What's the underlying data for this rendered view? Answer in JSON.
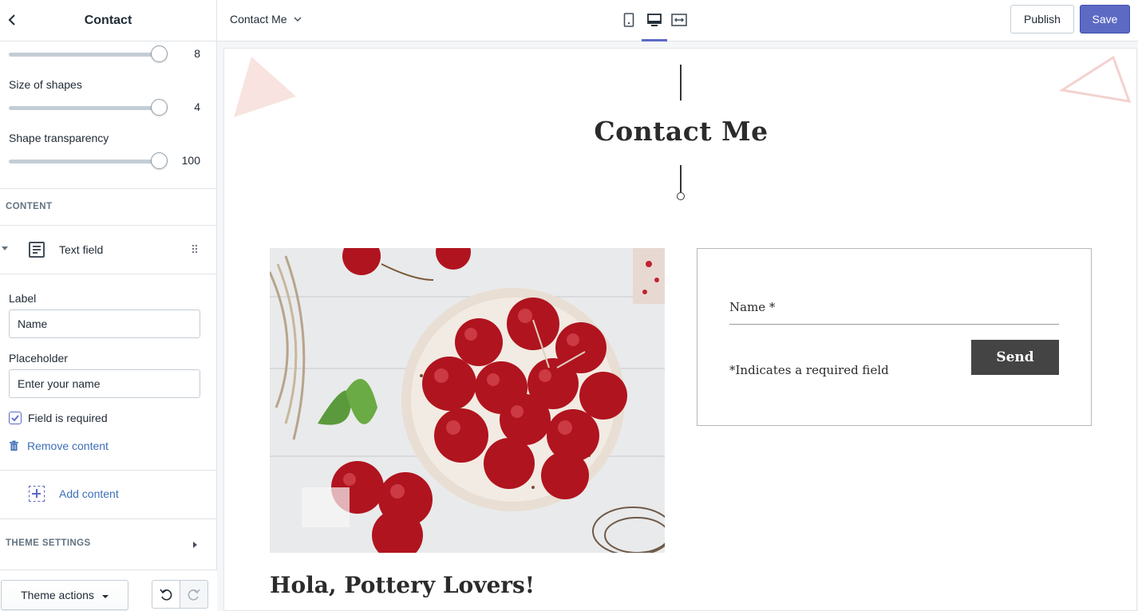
{
  "sidebar": {
    "title": "Contact",
    "sliders": [
      {
        "label": "",
        "value": "8"
      },
      {
        "label": "Size of shapes",
        "value": "4"
      },
      {
        "label": "Shape transparency",
        "value": "100"
      }
    ],
    "content_section_title": "CONTENT",
    "content_item": {
      "label": "Text field"
    },
    "label_field": {
      "label": "Label",
      "value": "Name"
    },
    "placeholder_field": {
      "label": "Placeholder",
      "value": "Enter your name"
    },
    "required_checkbox": {
      "label": "Field is required",
      "checked": true
    },
    "remove_label": "Remove content",
    "add_label": "Add content",
    "theme_settings_label": "THEME SETTINGS",
    "theme_actions_label": "Theme actions"
  },
  "topbar": {
    "page_selector": "Contact Me",
    "publish_label": "Publish",
    "save_label": "Save",
    "accent_color": "#5c6ac4"
  },
  "preview": {
    "title": "Contact Me",
    "form": {
      "name_label": "Name *",
      "required_note": "*Indicates a required field",
      "send_label": "Send"
    },
    "heading": "Hola, Pottery Lovers!"
  }
}
